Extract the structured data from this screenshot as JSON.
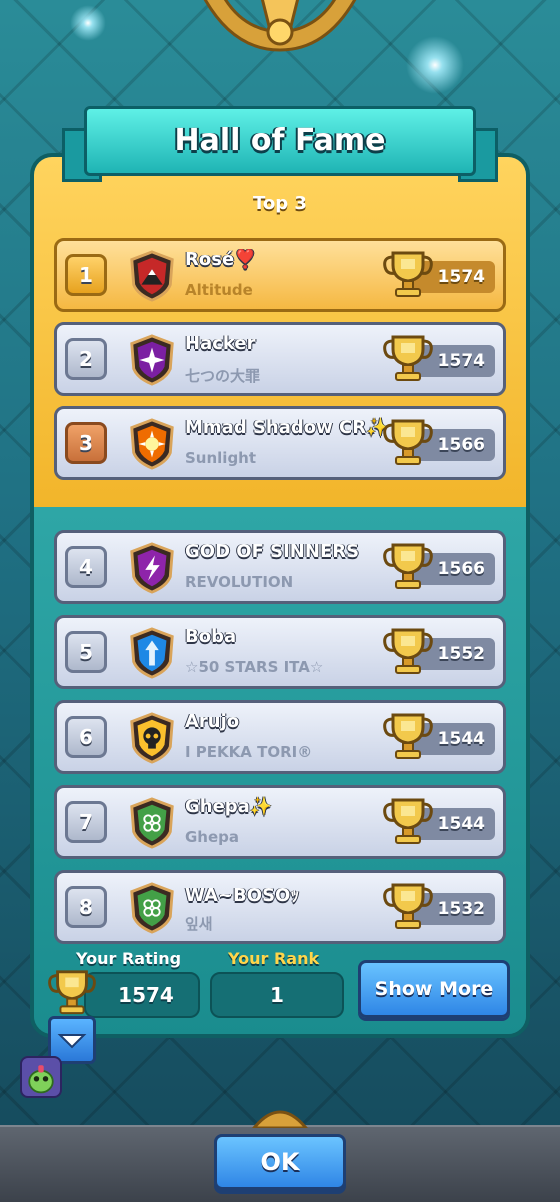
{
  "title": "Hall of Fame",
  "section_label": "Top 3",
  "players": [
    {
      "rank": "1",
      "name": "Rosé❣️",
      "clan": "Altitude",
      "trophies": "1574",
      "badge_icon": "mountain-badge-icon",
      "badge_color": "#c62828"
    },
    {
      "rank": "2",
      "name": "Hacker",
      "clan": "七つの大罪",
      "trophies": "1574",
      "badge_icon": "star-burst-badge-icon",
      "badge_color": "#7b1fa2"
    },
    {
      "rank": "3",
      "name": "Mmad Shadow CR✨",
      "clan": "Sunlight",
      "trophies": "1566",
      "badge_icon": "sun-badge-icon",
      "badge_color": "#ef6c00"
    },
    {
      "rank": "4",
      "name": "GOD OF SINNERS",
      "clan": "REVOLUTION",
      "trophies": "1566",
      "badge_icon": "lightning-badge-icon",
      "badge_color": "#8e24aa"
    },
    {
      "rank": "5",
      "name": "Boba",
      "clan": "☆50 STARS ITA☆",
      "trophies": "1552",
      "badge_icon": "arrow-badge-icon",
      "badge_color": "#1e88e5"
    },
    {
      "rank": "6",
      "name": "Arujo",
      "clan": "I PEKKA TORI®",
      "trophies": "1544",
      "badge_icon": "skull-badge-icon",
      "badge_color": "#fbc02d"
    },
    {
      "rank": "7",
      "name": "Ghepa✨",
      "clan": "Ghepa",
      "trophies": "1544",
      "badge_icon": "clover-badge-icon",
      "badge_color": "#43a047"
    },
    {
      "rank": "8",
      "name": "WA~BOSOｯ",
      "clan": "잎새",
      "trophies": "1532",
      "badge_icon": "clover-badge-icon",
      "badge_color": "#43a047"
    }
  ],
  "your_rating_label": "Your Rating",
  "your_rating_value": "1574",
  "your_rank_label": "Your Rank",
  "your_rank_value": "1",
  "show_more_label": "Show More",
  "ok_label": "OK",
  "colors": {
    "panel_gold": "#f2b52a",
    "panel_teal": "#1a8c8e",
    "button_blue": "#2f86e6",
    "your_rating_label": "#ffffff",
    "your_rank_label": "#ffd54a"
  }
}
